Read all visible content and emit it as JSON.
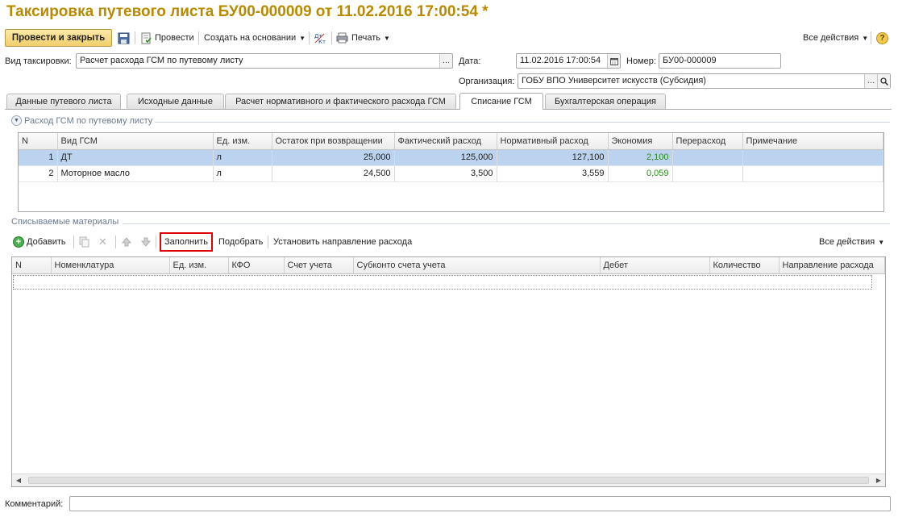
{
  "title": "Таксировка путевого листа БУ00-000009 от 11.02.2016 17:00:54 *",
  "toolbar": {
    "post_close": "Провести и закрыть",
    "post": "Провести",
    "create_based_on": "Создать на основании",
    "print": "Печать",
    "all_actions": "Все действия"
  },
  "form": {
    "taxing_type_label": "Вид таксировки:",
    "taxing_type_value": "Расчет расхода ГСМ по путевому листу",
    "date_label": "Дата:",
    "date_value": "11.02.2016 17:00:54",
    "number_label": "Номер:",
    "number_value": "БУ00-000009",
    "org_label": "Организация:",
    "org_value": "ГОБУ ВПО Университет искусств (Субсидия)",
    "comment_label": "Комментарий:",
    "comment_value": ""
  },
  "tabs": [
    {
      "label": "Данные путевого листа"
    },
    {
      "label": "Исходные данные"
    },
    {
      "label": "Расчет нормативного и фактического расхода ГСМ"
    },
    {
      "label": "Списание ГСМ"
    },
    {
      "label": "Бухгалтерская операция"
    }
  ],
  "fuel_section": {
    "title": "Расход ГСМ по путевому листу",
    "columns": [
      "N",
      "Вид ГСМ",
      "Ед. изм.",
      "Остаток при возвращении",
      "Фактический расход",
      "Нормативный расход",
      "Экономия",
      "Перерасход",
      "Примечание"
    ],
    "rows": [
      {
        "n": "1",
        "type": "ДТ",
        "unit": "л",
        "remainder": "25,000",
        "actual": "125,000",
        "norm": "127,100",
        "economy": "2,100",
        "overrun": "",
        "note": ""
      },
      {
        "n": "2",
        "type": "Моторное масло",
        "unit": "л",
        "remainder": "24,500",
        "actual": "3,500",
        "norm": "3,559",
        "economy": "0,059",
        "overrun": "",
        "note": ""
      }
    ]
  },
  "materials_section": {
    "title": "Списываемые материалы",
    "add": "Добавить",
    "fill": "Заполнить",
    "pick": "Подобрать",
    "set_direction": "Установить направление расхода",
    "all_actions": "Все действия",
    "columns": [
      "N",
      "Номенклатура",
      "Ед. изм.",
      "КФО",
      "Счет учета",
      "Субконто счета учета",
      "Дебет",
      "Количество",
      "Направление расхода"
    ]
  },
  "colors": {
    "title": "#b88a00",
    "selection": "#bcd3ef",
    "economy": "#2a8a1c",
    "highlight": "#e00000"
  }
}
